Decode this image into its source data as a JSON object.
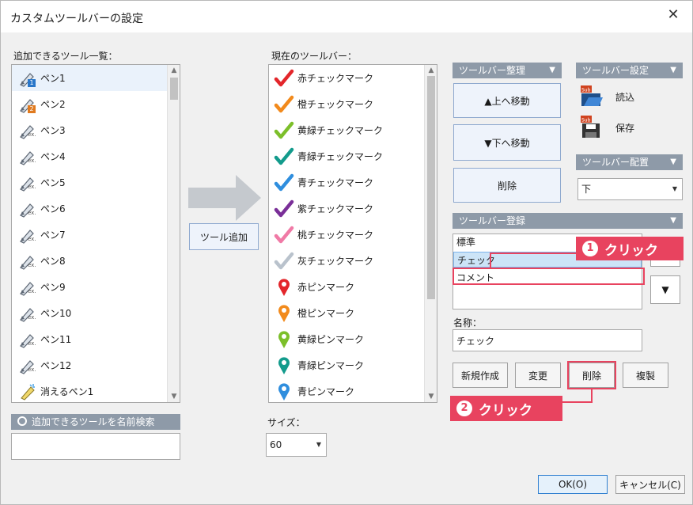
{
  "window": {
    "title": "カスタムツールバーの設定",
    "close": "✕"
  },
  "available": {
    "label": "追加できるツール一覧：",
    "items": [
      {
        "label": "ペン1",
        "badge": "1",
        "badge_color": "#2a77c9"
      },
      {
        "label": "ペン2",
        "badge": "2",
        "badge_color": "#e07a1f"
      },
      {
        "label": "ペン3",
        "badge": "ex.",
        "badge_color": ""
      },
      {
        "label": "ペン4",
        "badge": "ex.",
        "badge_color": ""
      },
      {
        "label": "ペン5",
        "badge": "ex.",
        "badge_color": ""
      },
      {
        "label": "ペン6",
        "badge": "ex.",
        "badge_color": ""
      },
      {
        "label": "ペン7",
        "badge": "ex.",
        "badge_color": ""
      },
      {
        "label": "ペン8",
        "badge": "ex.",
        "badge_color": ""
      },
      {
        "label": "ペン9",
        "badge": "ex.",
        "badge_color": ""
      },
      {
        "label": "ペン10",
        "badge": "ex.",
        "badge_color": ""
      },
      {
        "label": "ペン11",
        "badge": "ex.",
        "badge_color": ""
      },
      {
        "label": "ペン12",
        "badge": "ex.",
        "badge_color": ""
      },
      {
        "label": "消えるペン1",
        "badge": "",
        "badge_color": ""
      }
    ],
    "search_label": "追加できるツールを名前検索",
    "search_value": ""
  },
  "add_button": "ツール追加",
  "current": {
    "label": "現在のツールバー：",
    "items": [
      {
        "label": "赤チェックマーク",
        "kind": "check",
        "color": "#e3262b"
      },
      {
        "label": "橙チェックマーク",
        "kind": "check",
        "color": "#f28a1c"
      },
      {
        "label": "黄緑チェックマーク",
        "kind": "check",
        "color": "#7cbf2a"
      },
      {
        "label": "青緑チェックマーク",
        "kind": "check",
        "color": "#139b8c"
      },
      {
        "label": "青チェックマーク",
        "kind": "check",
        "color": "#2f8ede"
      },
      {
        "label": "紫チェックマーク",
        "kind": "check",
        "color": "#7a2f98"
      },
      {
        "label": "桃チェックマーク",
        "kind": "check",
        "color": "#f07aa6"
      },
      {
        "label": "灰チェックマーク",
        "kind": "check",
        "color": "#b9c2cc"
      },
      {
        "label": "赤ピンマーク",
        "kind": "pin",
        "color": "#e3262b"
      },
      {
        "label": "橙ピンマーク",
        "kind": "pin",
        "color": "#f28a1c"
      },
      {
        "label": "黄緑ピンマーク",
        "kind": "pin",
        "color": "#7cbf2a"
      },
      {
        "label": "青緑ピンマーク",
        "kind": "pin",
        "color": "#139b8c"
      },
      {
        "label": "青ピンマーク",
        "kind": "pin",
        "color": "#2f8ede"
      }
    ],
    "size_label": "サイズ：",
    "size_value": "60"
  },
  "organize": {
    "header": "ツールバー整理",
    "up": "▲上へ移動",
    "down": "▼下へ移動",
    "delete": "削除"
  },
  "settings": {
    "header": "ツールバー設定",
    "load": "読込",
    "save": "保存",
    "sub_badge": "Sub"
  },
  "placement": {
    "header": "ツールバー配置",
    "value": "下"
  },
  "register": {
    "header": "ツールバー登録",
    "items": [
      "標準",
      "チェック",
      "コメント"
    ],
    "selected_index": 1,
    "down_arrow": "▼",
    "name_label": "名称：",
    "name_value": "チェック",
    "new": "新規作成",
    "change": "変更",
    "delete": "削除",
    "duplicate": "複製"
  },
  "footer": {
    "ok": "OK(O)",
    "cancel": "キャンセル(C)"
  },
  "callouts": [
    {
      "num": "1",
      "text": "クリック"
    },
    {
      "num": "2",
      "text": "クリック"
    }
  ],
  "colors": {
    "accent": "#e8435f",
    "header": "#8e9aa8"
  }
}
